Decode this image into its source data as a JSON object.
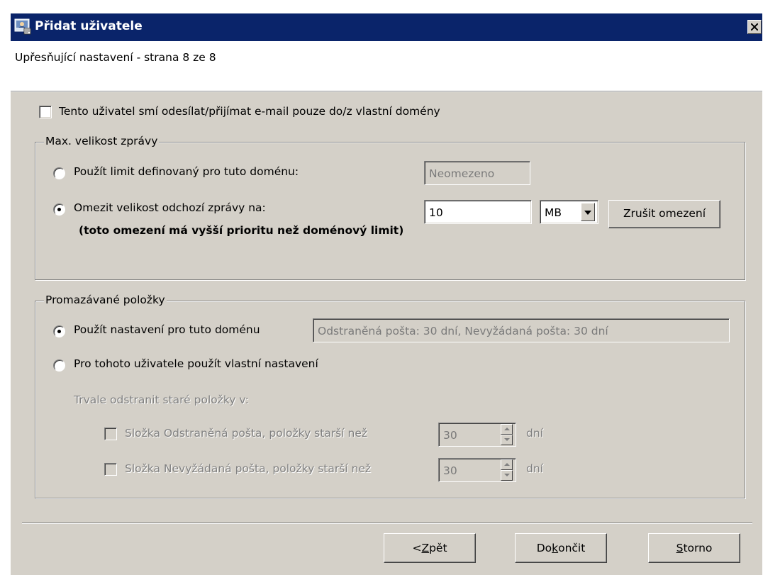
{
  "window": {
    "title": "Přidat uživatele",
    "close_label": "X"
  },
  "header": {
    "subtitle": "Upřesňující nastavení - strana 8 ze 8"
  },
  "own_domain_only": {
    "label": "Tento uživatel smí odesílat/přijímat e-mail pouze do/z vlastní domény",
    "checked": false
  },
  "max_size": {
    "legend": "Max. velikost zprávy",
    "use_domain_limit_label": "Použít limit definovaný pro tuto doménu:",
    "domain_limit_value": "Neomezeno",
    "limit_outgoing_label": "Omezit velikost odchozí zprávy na:",
    "limit_outgoing_note": "(toto omezení má vyšší prioritu než doménový limit)",
    "limit_value": "10",
    "unit": "MB",
    "cancel_limit_label": "Zrušit omezení",
    "selected": "limit_outgoing"
  },
  "purge": {
    "legend": "Promazávané položky",
    "use_domain_label": "Použít nastavení pro tuto doménu",
    "domain_settings_value": "Odstraněná pošta: 30 dní, Nevyžádaná pošta: 30 dní",
    "custom_label": "Pro tohoto uživatele použít vlastní nastavení",
    "selected": "use_domain",
    "delete_heading": "Trvale odstranit staré položky v:",
    "deleted_folder": {
      "label": "Složka Odstraněná pošta, položky starší než",
      "value": "30",
      "unit": "dní"
    },
    "junk_folder": {
      "label": "Složka Nevyžádaná pošta, položky starší než",
      "value": "30",
      "unit": "dní"
    }
  },
  "buttons": {
    "back_prefix": "< ",
    "back_key": "Z",
    "back_rest": "pět",
    "finish_pre": "Do",
    "finish_key": "k",
    "finish_rest": "ončit",
    "cancel_key": "S",
    "cancel_rest": "torno"
  },
  "colors": {
    "titlebar": "#0a246a",
    "dialog_bg": "#d4d0c8",
    "disabled_text": "#808080"
  }
}
